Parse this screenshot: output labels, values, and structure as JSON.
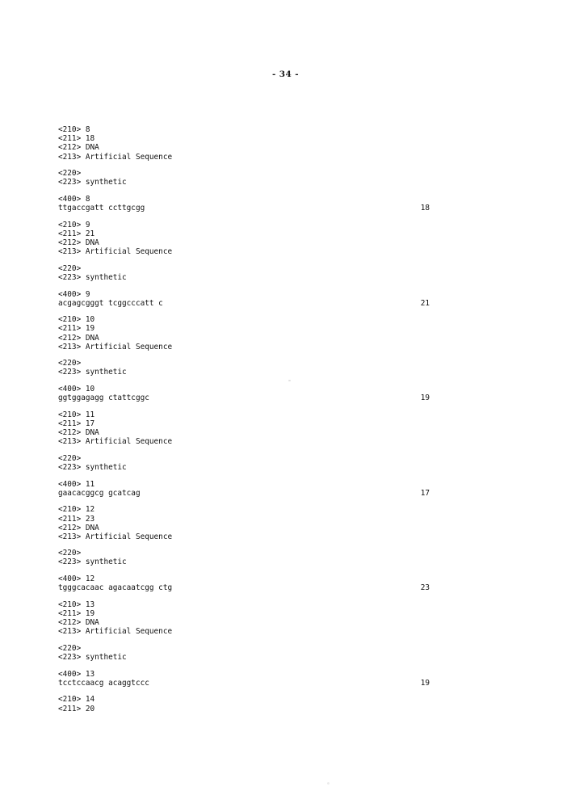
{
  "page": {
    "folio": "- 34 -"
  },
  "listing": [
    {
      "id": "seq-8",
      "header": [
        "<210> 8",
        "<211> 18",
        "<212> DNA",
        "<213> Artificial Sequence"
      ],
      "feature": [
        "<220>",
        "<223> synthetic"
      ],
      "seq_tag": "<400> 8",
      "sequence": "ttgaccgatt ccttgcgg",
      "length": "18"
    },
    {
      "id": "seq-9",
      "header": [
        "<210> 9",
        "<211> 21",
        "<212> DNA",
        "<213> Artificial Sequence"
      ],
      "feature": [
        "<220>",
        "<223> synthetic"
      ],
      "seq_tag": "<400> 9",
      "sequence": "acgagcgggt tcggcccatt c",
      "length": "21"
    },
    {
      "id": "seq-10",
      "header": [
        "<210> 10",
        "<211> 19",
        "<212> DNA",
        "<213> Artificial Sequence"
      ],
      "feature": [
        "<220>",
        "<223> synthetic"
      ],
      "seq_tag": "<400> 10",
      "sequence": "ggtggagagg ctattcggc",
      "length": "19"
    },
    {
      "id": "seq-11",
      "header": [
        "<210> 11",
        "<211> 17",
        "<212> DNA",
        "<213> Artificial Sequence"
      ],
      "feature": [
        "<220>",
        "<223> synthetic"
      ],
      "seq_tag": "<400> 11",
      "sequence": "gaacacggcg gcatcag",
      "length": "17"
    },
    {
      "id": "seq-12",
      "header": [
        "<210> 12",
        "<211> 23",
        "<212> DNA",
        "<213> Artificial Sequence"
      ],
      "feature": [
        "<220>",
        "<223> synthetic"
      ],
      "seq_tag": "<400> 12",
      "sequence": "tgggcacaac agacaatcgg ctg",
      "length": "23"
    },
    {
      "id": "seq-13",
      "header": [
        "<210> 13",
        "<211> 19",
        "<212> DNA",
        "<213> Artificial Sequence"
      ],
      "feature": [
        "<220>",
        "<223> synthetic"
      ],
      "seq_tag": "<400> 13",
      "sequence": "tcctccaacg acaggtccc",
      "length": "19"
    },
    {
      "id": "seq-14-partial",
      "header": [
        "<210> 14",
        "<211> 20"
      ],
      "feature": [],
      "seq_tag": "",
      "sequence": "",
      "length": ""
    }
  ]
}
